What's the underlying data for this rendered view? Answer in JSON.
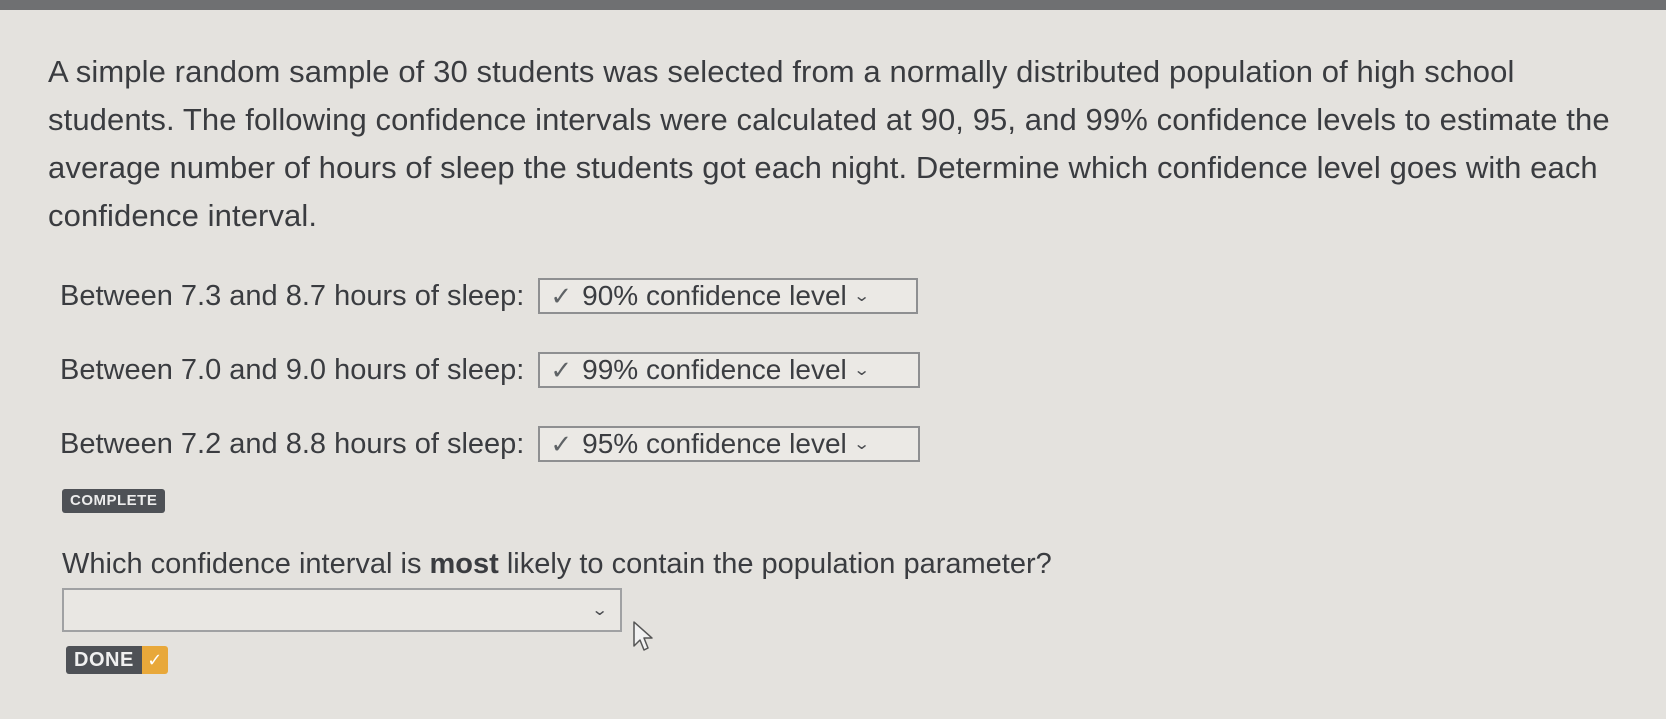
{
  "question_text": "A simple random sample of 30 students was selected from a normally distributed population of high school students. The following confidence intervals were calculated at 90, 95, and 99% confidence levels to estimate the average number of hours of sleep the students got each night. Determine which confidence level goes with each confidence interval.",
  "matches": [
    {
      "label": "Between 7.3 and 8.7 hours of sleep:",
      "selected": "90% confidence level",
      "status": "correct"
    },
    {
      "label": "Between 7.0 and 9.0 hours of sleep:",
      "selected": "99% confidence level",
      "status": "correct"
    },
    {
      "label": "Between 7.2 and 8.8 hours of sleep:",
      "selected": "95% confidence level",
      "status": "correct"
    }
  ],
  "complete_badge": "COMPLETE",
  "question2": {
    "before": "Which confidence interval is ",
    "bold": "most",
    "after": " likely to contain the population parameter?",
    "selected": ""
  },
  "done_button": {
    "label": "DONE"
  },
  "icons": {
    "check": "checkmark-icon",
    "dropdown": "chevron-down-icon",
    "cursor": "mouse-pointer-icon"
  },
  "colors": {
    "done_accent": "#e8a83a",
    "badge_bg": "#4e5156"
  }
}
